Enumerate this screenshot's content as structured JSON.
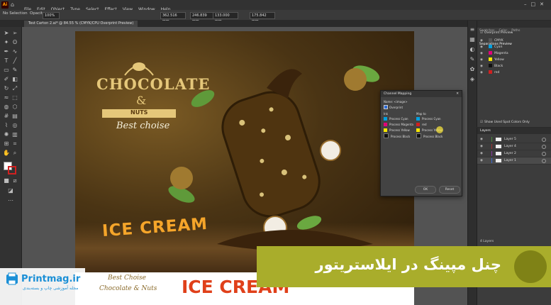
{
  "app": {
    "logo": "Ai",
    "menus": [
      "File",
      "Edit",
      "Object",
      "Type",
      "Select",
      "Effect",
      "View",
      "Window",
      "Help"
    ]
  },
  "control_bar": {
    "selection": "No Selection",
    "opacity_label": "Opacity:",
    "opacity_value": "100%",
    "x_value": "362.516 mm",
    "y_value": "246.839 mm",
    "w_value": "133.000 mm",
    "h_value": "175.842 mm"
  },
  "document": {
    "tab_label": "Test Carton 2.ai* @ 84.55 % (CMYK/CPU Overprint Preview)"
  },
  "artwork": {
    "brand": "CHOCOLATE",
    "amp": "&",
    "nuts": "NUTS",
    "best": "Best choise",
    "ice_cream": "ICE CREAM",
    "footer_script_1": "Best Choise",
    "footer_script_2": "Chocolate & Nuts",
    "footer_big": "ICE CREAM"
  },
  "separations_panel": {
    "tabs": [
      "Swatches",
      "Color",
      "Paths",
      "Separations Preview"
    ],
    "overprint_label": "Overprint Preview",
    "plates": [
      {
        "name": "CMYK",
        "color": "#555555"
      },
      {
        "name": "Cyan",
        "color": "#00a0e0"
      },
      {
        "name": "Magenta",
        "color": "#e0007a"
      },
      {
        "name": "Yellow",
        "color": "#f5e600"
      },
      {
        "name": "Black",
        "color": "#111111"
      },
      {
        "name": "red",
        "color": "#d02020"
      }
    ],
    "show_used_label": "Show Used Spot Colors Only"
  },
  "layers_panel": {
    "title": "Layers",
    "layers": [
      {
        "name": "Layer 5",
        "color": "#4a8a3a"
      },
      {
        "name": "Layer 4",
        "color": "#a03030"
      },
      {
        "name": "Layer 2",
        "color": "#8a3aa0"
      },
      {
        "name": "Layer 1",
        "color": "#3a6ad0"
      }
    ],
    "footer": "4 Layers"
  },
  "dialog": {
    "title": "Channel Mapping",
    "name_label": "Name: <image>",
    "checkbox_label": "Overprint",
    "ink_header": "Ink",
    "map_header": "Map to",
    "inks": [
      {
        "name": "Process Cyan",
        "color": "#00a0e0"
      },
      {
        "name": "Process Magenta",
        "color": "#e0007a"
      },
      {
        "name": "Process Yellow",
        "color": "#f5e600"
      },
      {
        "name": "Process Black",
        "color": "#111111"
      }
    ],
    "maps": [
      {
        "name": "Process Cyan",
        "color": "#00a0e0"
      },
      {
        "name": "red",
        "color": "#d02020"
      },
      {
        "name": "Process Yellow",
        "color": "#f5e600"
      },
      {
        "name": "Process Black",
        "color": "#111111"
      }
    ],
    "ok_label": "OK",
    "reset_label": "Reset"
  },
  "overlay": {
    "title": "چنل مپینگ در ایلاستریتور",
    "brand": "Printmag.ir",
    "tagline": "مجله آموزشی چاپ و بسته‌بندی",
    "accent": "#a9ad2b"
  }
}
